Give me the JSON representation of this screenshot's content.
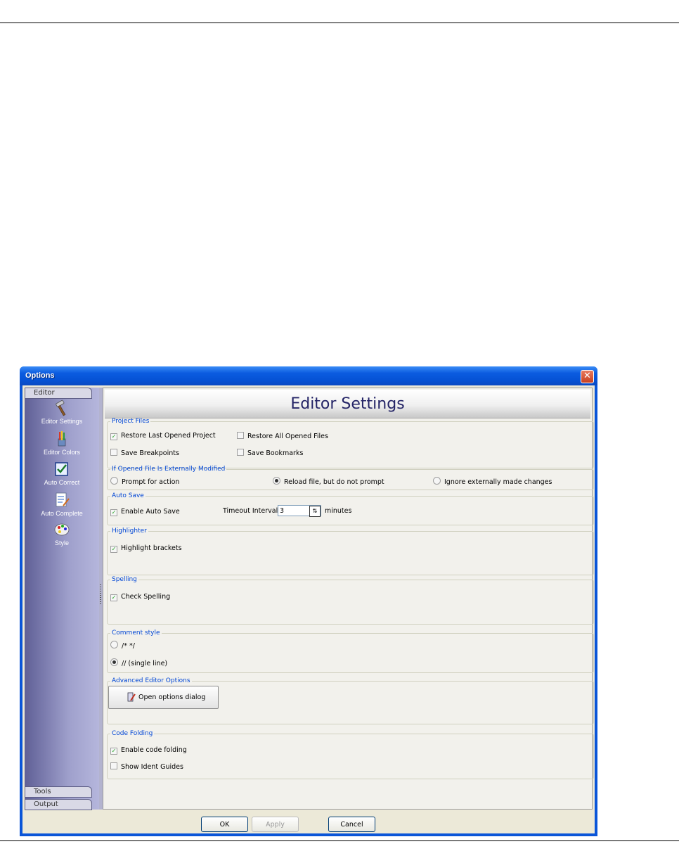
{
  "window": {
    "title": "Options",
    "close_glyph": "✕"
  },
  "nav": {
    "top_tab": "Editor",
    "items": [
      {
        "label": "Editor Settings",
        "icon": "hammer-icon"
      },
      {
        "label": "Editor Colors",
        "icon": "paint-brushes-icon"
      },
      {
        "label": "Auto Correct",
        "icon": "checkmark-document-icon"
      },
      {
        "label": "Auto Complete",
        "icon": "edit-document-icon"
      },
      {
        "label": "Style",
        "icon": "palette-icon"
      }
    ],
    "bottom_tabs": [
      "Tools",
      "Output"
    ]
  },
  "header": {
    "title": "Editor Settings"
  },
  "project_files": {
    "legend": "Project Files",
    "restore_last": {
      "label": "Restore Last Opened Project",
      "checked": true
    },
    "restore_all": {
      "label": "Restore All Opened Files",
      "checked": false
    },
    "save_breakpoints": {
      "label": "Save Breakpoints",
      "checked": false
    },
    "save_bookmarks": {
      "label": "Save Bookmarks",
      "checked": false
    }
  },
  "external_mod": {
    "legend": "If Opened File Is Externally Modified",
    "options": [
      {
        "label": "Prompt for action",
        "selected": false
      },
      {
        "label": "Reload file, but do not prompt",
        "selected": true
      },
      {
        "label": "Ignore externally made changes",
        "selected": false
      }
    ]
  },
  "auto_save": {
    "legend": "Auto Save",
    "enable": {
      "label": "Enable Auto Save",
      "checked": true
    },
    "timeout_label": "Timeout Interval:",
    "timeout_value": "3",
    "timeout_unit": "minutes"
  },
  "highlighter": {
    "legend": "Highlighter",
    "brackets": {
      "label": "Highlight brackets",
      "checked": true
    }
  },
  "spelling": {
    "legend": "Spelling",
    "check": {
      "label": "Check Spelling",
      "checked": true
    }
  },
  "comment_style": {
    "legend": "Comment style",
    "options": [
      {
        "label": "/* */",
        "selected": false
      },
      {
        "label": "// (single line)",
        "selected": true
      }
    ]
  },
  "advanced": {
    "legend": "Advanced Editor Options",
    "button_label": "Open options dialog"
  },
  "code_folding": {
    "legend": "Code Folding",
    "enable": {
      "label": "Enable code folding",
      "checked": true
    },
    "guides": {
      "label": "Show Ident Guides",
      "checked": false
    }
  },
  "footer": {
    "ok": "OK",
    "apply": "Apply",
    "cancel": "Cancel"
  },
  "glyphs": {
    "check": "✓",
    "spin": "⇅"
  }
}
